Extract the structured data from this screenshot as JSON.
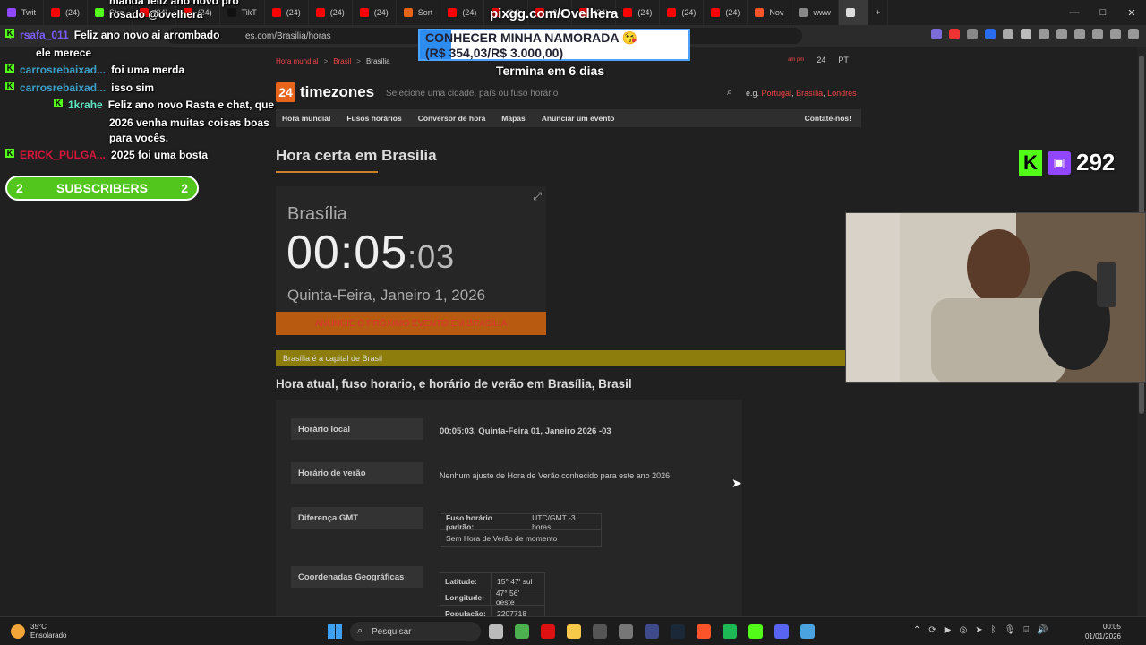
{
  "browser": {
    "tabs": [
      {
        "label": "Twit",
        "color": "#9146ff"
      },
      {
        "label": "(24)",
        "color": "#ff0000"
      },
      {
        "label": "Stre",
        "color": "#53fc18"
      },
      {
        "label": "(24)",
        "color": "#ff0000"
      },
      {
        "label": "(24)",
        "color": "#ff0000"
      },
      {
        "label": "TikT",
        "color": "#111111"
      },
      {
        "label": "(24)",
        "color": "#ff0000"
      },
      {
        "label": "(24)",
        "color": "#ff0000"
      },
      {
        "label": "(24)",
        "color": "#ff0000"
      },
      {
        "label": "Sort",
        "color": "#e8641b"
      },
      {
        "label": "(24)",
        "color": "#ff0000"
      },
      {
        "label": "(24)",
        "color": "#ff0000"
      },
      {
        "label": "(24)",
        "color": "#ff0000"
      },
      {
        "label": "(24)",
        "color": "#ff0000"
      },
      {
        "label": "(24)",
        "color": "#ff0000"
      },
      {
        "label": "(24)",
        "color": "#ff0000"
      },
      {
        "label": "(24)",
        "color": "#ff0000"
      },
      {
        "label": "Nov",
        "color": "#fb542b"
      },
      {
        "label": "www",
        "color": "#888888"
      },
      {
        "label": "",
        "color": "#dddddd"
      }
    ],
    "new_tab": "+",
    "url": "es.com/Brasilia/horas"
  },
  "site": {
    "breadcrumb": [
      "Hora mundial",
      "Brasil",
      "Brasília"
    ],
    "breadcrumb_sep": ">",
    "top_small": "am pm",
    "top_24": "24",
    "top_lang": "PT",
    "logo_badge": "24",
    "logo_word": "timezones",
    "search_placeholder": "Selecione uma cidade, país ou fuso horário",
    "eg_label": "e.g.",
    "eg_links": [
      "Portugal",
      "Brasília",
      "Londres"
    ],
    "nav": [
      "Hora mundial",
      "Fusos horários",
      "Conversor de hora",
      "Mapas",
      "Anunciar um evento"
    ],
    "nav_contact": "Contate-nos!",
    "h1": "Hora certa em Brasília",
    "clock": {
      "city": "Brasília",
      "time": "00:05",
      "seconds": ":03",
      "date": "Quinta-Feira, Janeiro 1, 2026",
      "announce": "ANUNCIE O PRÓXIMO EVENTO EM BRASÍLIA"
    },
    "capital_note": "Brasília é a capital de Brasil",
    "h2": "Hora atual, fuso horario, e horário de verão em Brasília, Brasil",
    "info": {
      "local_label": "Horário local",
      "local_value": "00:05:03, Quinta-Feira 01, Janeiro 2026 -03",
      "dst_label": "Horário de verão",
      "dst_value": "Nenhum ajuste de Hora de Verão conhecido para este ano 2026",
      "gmt_label": "Diferença GMT",
      "gmt_k": "Fuso horário padrão:",
      "gmt_v": "UTC/GMT -3 horas",
      "gmt_note": "Sem Hora de Verão de momento",
      "coords_label": "Coordenadas Geográficas",
      "lat_k": "Latitude:",
      "lat_v": "15° 47' sul",
      "lon_k": "Longitude:",
      "lon_v": "47° 56' oeste",
      "pop_k": "População:",
      "pop_v": "2207718"
    }
  },
  "overlay": {
    "chat": [
      {
        "user": "",
        "msg": "manda feliz ano novo pro",
        "color": "#ffffff"
      },
      {
        "user": "",
        "msg": "rosado @ovelhera",
        "color": "#ffffff"
      },
      {
        "user": "rsafa_011",
        "msg": "Feliz ano novo ai arrombado",
        "color": "#7b5cff"
      },
      {
        "user": "",
        "msg": "ele merece",
        "color": "#ffffff"
      },
      {
        "user": "carrosrebaixad...",
        "msg": "foi uma merda",
        "color": "#3aa0c8"
      },
      {
        "user": "carrosrebaixad...",
        "msg": "isso sim",
        "color": "#3aa0c8"
      },
      {
        "user": "1krahe",
        "msg": "Feliz ano novo Rasta e chat, que",
        "color": "#5fe3c0"
      },
      {
        "user": "",
        "msg": "2026 venha muitas coisas boas",
        "color": "#ffffff"
      },
      {
        "user": "",
        "msg": "para vocês.",
        "color": "#ffffff"
      },
      {
        "user": "ERICK_PULGA...",
        "msg": "2025 foi uma bosta",
        "color": "#d4163a"
      }
    ],
    "subs_left": "2",
    "subs_label": "SUBSCRIBERS",
    "subs_right": "2",
    "pixgg": "pixgg.com/Ovelhera",
    "goal_title": "CONHECER MINHA NAMORADA 😘",
    "goal_amount": "(R$ 354,03/R$ 3.000,00)",
    "goal_progress": 0.118,
    "goal_end": "Termina em 6 dias",
    "viewer_count": "292"
  },
  "taskbar": {
    "temp": "35°C",
    "weather": "Ensolarado",
    "search": "Pesquisar",
    "time": "00:05",
    "date": "01/01/2026"
  }
}
